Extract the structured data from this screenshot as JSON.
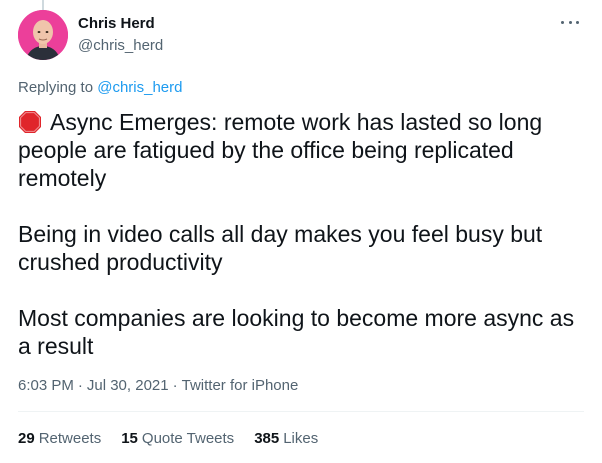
{
  "author": {
    "name": "Chris Herd",
    "handle": "@chris_herd"
  },
  "icons": {
    "avatar": "profile-photo",
    "more": "more-options-icon",
    "stop_emoji": "stop-sign-icon"
  },
  "reply": {
    "prefix": "Replying to ",
    "mention": "@chris_herd"
  },
  "body": {
    "line1": "Async Emerges: remote work has lasted so long people are fatigued by the office being replicated remotely",
    "line2": "Being in video calls all day makes you feel busy but crushed productivity",
    "line3": "Most companies are looking to become more async as a result"
  },
  "meta": {
    "time": "6:03 PM",
    "date": "Jul 30, 2021",
    "source": "Twitter for iPhone"
  },
  "stats": {
    "retweets_count": "29",
    "retweets_label": "Retweets",
    "quotes_count": "15",
    "quotes_label": "Quote Tweets",
    "likes_count": "385",
    "likes_label": "Likes"
  },
  "colors": {
    "link": "#1d9bf0",
    "secondary_text": "#536471",
    "primary_text": "#0f1419",
    "avatar_bg": "#ec3f9a",
    "stop_sign": "#e0252b"
  }
}
